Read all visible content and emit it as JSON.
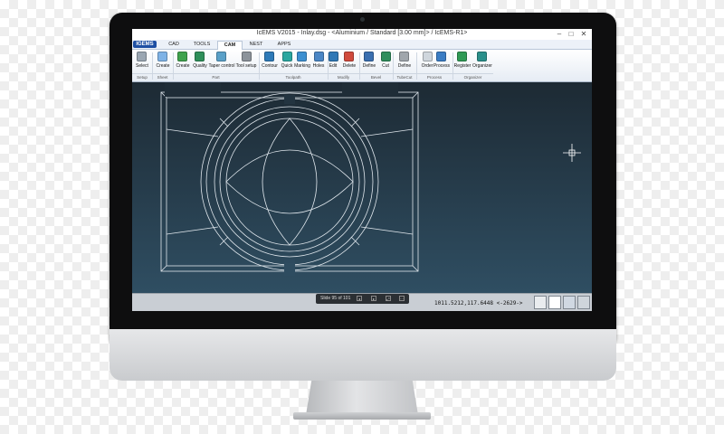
{
  "window": {
    "title": "IcEMS V2015 - Inlay.dsg - <Aluminium / Standard [3.00 mm]> / IcEMS-R1>",
    "controls": [
      "–",
      "□",
      "✕"
    ]
  },
  "app_menu": {
    "label": "IGEMS"
  },
  "tabs": [
    {
      "label": "CAD",
      "active": false
    },
    {
      "label": "TOOLS",
      "active": false
    },
    {
      "label": "CAM",
      "active": true
    },
    {
      "label": "NEST",
      "active": false
    },
    {
      "label": "APPS",
      "active": false
    }
  ],
  "ribbon": {
    "tools": [
      {
        "label": "Select",
        "icon": "arrow-cursor-icon",
        "color": "#9aa6b2"
      },
      {
        "label": "Create",
        "icon": "sheet-icon",
        "color": "#7fb3e6"
      },
      {
        "label": "Create",
        "icon": "part-icon",
        "color": "#3fa34d"
      },
      {
        "label": "Quality",
        "icon": "quality-icon",
        "color": "#2f8f5a"
      },
      {
        "label": "Taper control",
        "icon": "taper-icon",
        "color": "#5aa0c8"
      },
      {
        "label": "Tool setup",
        "icon": "tool-setup-icon",
        "color": "#8c939a"
      },
      {
        "label": "Contour",
        "icon": "contour-icon",
        "color": "#2e7ab8"
      },
      {
        "label": "Quick",
        "icon": "quick-icon",
        "color": "#2aa7a0"
      },
      {
        "label": "Marking",
        "icon": "marking-icon",
        "color": "#3c8fd0"
      },
      {
        "label": "Holes",
        "icon": "holes-icon",
        "color": "#4a86c5"
      },
      {
        "label": "Edit",
        "icon": "edit-icon",
        "color": "#2f78b6"
      },
      {
        "label": "Delete",
        "icon": "delete-icon",
        "color": "#d04a3c"
      },
      {
        "label": "Define",
        "icon": "define-bevel-icon",
        "color": "#3a6fb0"
      },
      {
        "label": "Cut",
        "icon": "cut-icon",
        "color": "#2f8e5c"
      },
      {
        "label": "Define",
        "icon": "define-tubecut-icon",
        "color": "#a0a6ac"
      },
      {
        "label": "Order",
        "icon": "order-icon",
        "color": "#cfd6dd"
      },
      {
        "label": "Process",
        "icon": "process-icon",
        "color": "#3b7dc4"
      },
      {
        "label": "Register",
        "icon": "register-icon",
        "color": "#2f9a55"
      },
      {
        "label": "Organizer",
        "icon": "organizer-icon",
        "color": "#2a8f8a"
      }
    ],
    "groups": [
      "Setup",
      "Sheet",
      "Part",
      "Toolpath",
      "Modify",
      "Bevel",
      "TubeCut",
      "Process",
      "Organizer"
    ]
  },
  "statusbar": {
    "coords": "1011.5212,117.6448 <-2629->"
  },
  "slide_toolbar": {
    "text": "Slide 95 of 101"
  }
}
